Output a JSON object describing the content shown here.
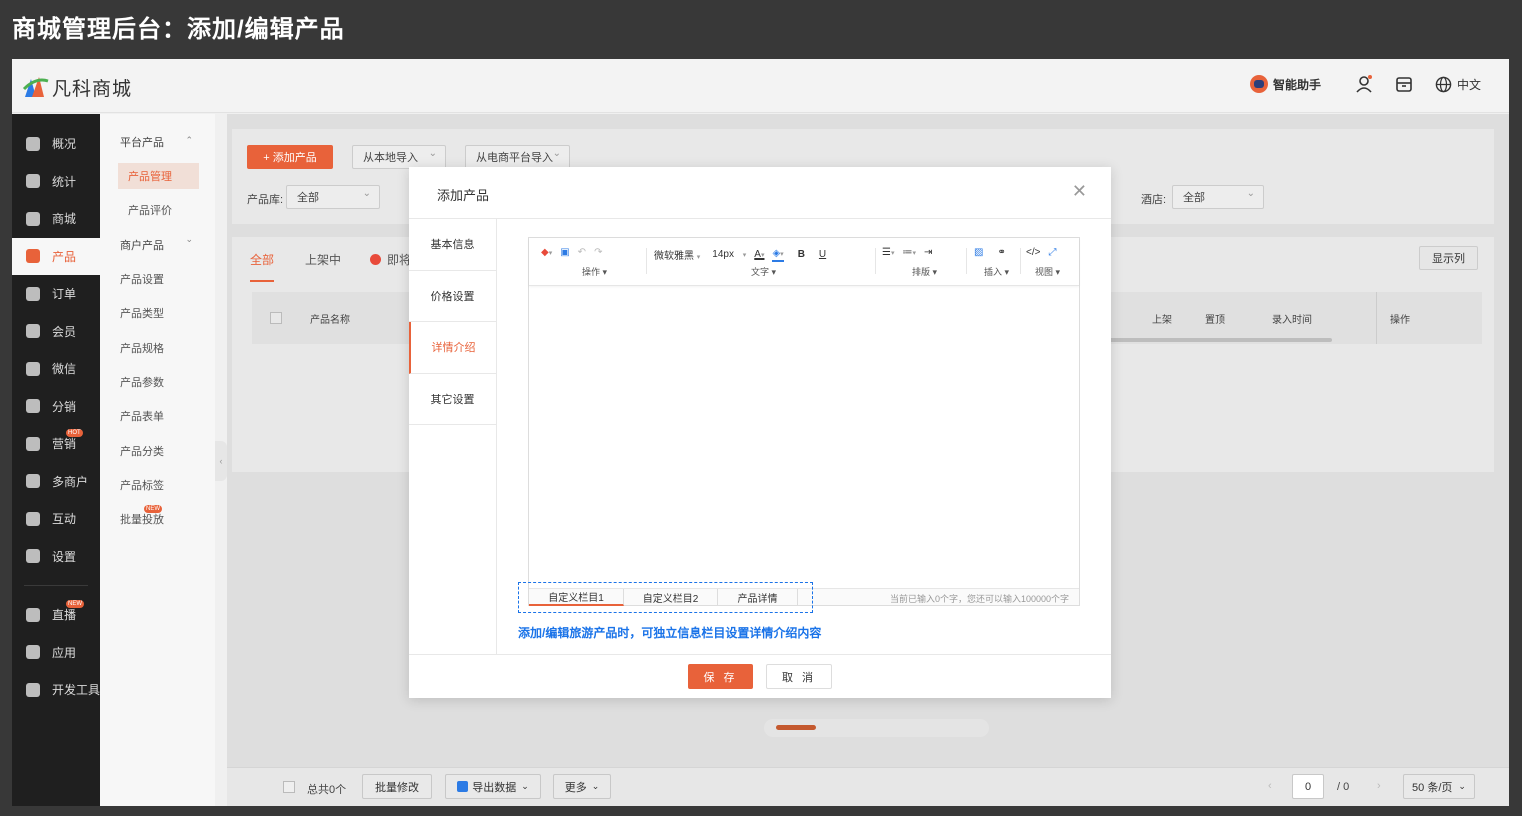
{
  "banner": {
    "title": "商城管理后台：添加/编辑产品"
  },
  "topbar": {
    "logo_text": "凡科商城",
    "assistant": "智能助手",
    "language": "中文"
  },
  "sidenav": {
    "items": [
      {
        "label": "概况",
        "icon": "layers-icon"
      },
      {
        "label": "统计",
        "icon": "chart-icon"
      },
      {
        "label": "商城",
        "icon": "shop-icon"
      },
      {
        "label": "产品",
        "icon": "grid-icon"
      },
      {
        "label": "订单",
        "icon": "order-icon"
      },
      {
        "label": "会员",
        "icon": "crown-icon"
      },
      {
        "label": "微信",
        "icon": "wechat-icon"
      },
      {
        "label": "分销",
        "icon": "users-icon"
      },
      {
        "label": "营销",
        "icon": "flag-icon",
        "badge": "HOT"
      },
      {
        "label": "多商户",
        "icon": "store-icon"
      },
      {
        "label": "互动",
        "icon": "interact-icon"
      },
      {
        "label": "设置",
        "icon": "gear-icon"
      },
      {
        "label": "直播",
        "icon": "tv-icon",
        "badge": "NEW"
      },
      {
        "label": "应用",
        "icon": "apps-icon"
      },
      {
        "label": "开发工具",
        "icon": "tools-icon"
      }
    ],
    "active": "产品"
  },
  "subnav": {
    "group1": "平台产品",
    "group1_items": [
      "产品管理",
      "产品评价"
    ],
    "group2": "商户产品",
    "items": [
      "产品设置",
      "产品类型",
      "产品规格",
      "产品参数",
      "产品表单",
      "产品分类",
      "产品标签",
      "批量投放"
    ],
    "new_badge": "NEW"
  },
  "content": {
    "add_button": "+ 添加产品",
    "import_local": "从本地导入",
    "import_platform": "从电商平台导入",
    "lib_label": "产品库:",
    "lib_value": "全部",
    "hotel_label": "酒店:",
    "hotel_value": "全部",
    "tabs": [
      "全部",
      "上架中",
      "即将"
    ],
    "show_columns": "显示列",
    "columns": {
      "name": "产品名称",
      "shelf": "上架",
      "top": "置顶",
      "time": "录入时间",
      "op": "操作"
    }
  },
  "footer": {
    "total": "总共0个",
    "batch_edit": "批量修改",
    "export": "导出数据",
    "more": "更多",
    "page": "0",
    "pages": "/ 0",
    "page_size": "50 条/页"
  },
  "modal": {
    "title": "添加产品",
    "tabs": [
      "基本信息",
      "价格设置",
      "详情介绍",
      "其它设置"
    ],
    "active_tab": "详情介绍",
    "toolbar": {
      "font": "微软雅黑",
      "size": "14px",
      "groups": [
        "操作",
        "文字",
        "排版",
        "插入",
        "视图"
      ]
    },
    "custom_tabs": [
      "自定义栏目1",
      "自定义栏目2",
      "产品详情"
    ],
    "char_count": "当前已输入0个字，您还可以输入100000个字",
    "note": "添加/编辑旅游产品时，可独立信息栏目设置详情介绍内容",
    "save": "保 存",
    "cancel": "取 消"
  },
  "colors": {
    "accent": "#e8623a",
    "note_blue": "#1a73e8"
  }
}
